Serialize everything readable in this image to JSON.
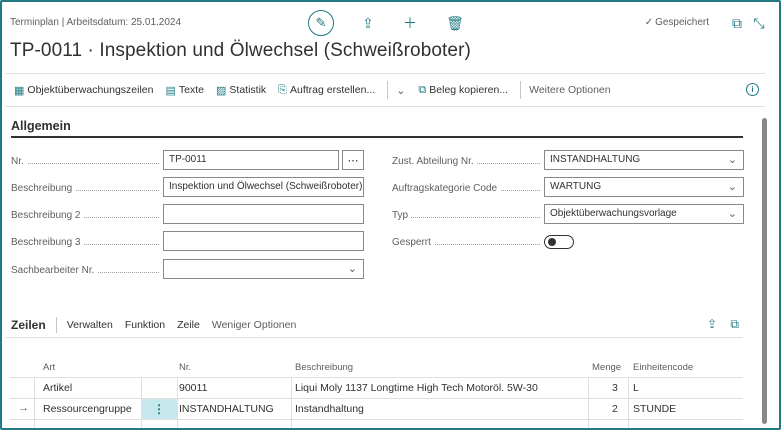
{
  "header": {
    "breadcrumb": "Terminplan | Arbeitsdatum: 25.01.2024",
    "saved_label": "Gespeichert",
    "title": "TP-0011 · Inspektion und Ölwechsel (Schweißroboter)"
  },
  "actions": {
    "items": [
      {
        "label": "Objektüberwachungszeilen",
        "icon": "grid-icon"
      },
      {
        "label": "Texte",
        "icon": "notes-icon"
      },
      {
        "label": "Statistik",
        "icon": "chart-icon"
      },
      {
        "label": "Auftrag erstellen...",
        "icon": "create-order-icon"
      },
      {
        "label": "Beleg kopieren...",
        "icon": "copy-icon"
      }
    ],
    "more_label": "Weitere Optionen"
  },
  "general": {
    "section_title": "Allgemein",
    "fields_left": [
      {
        "label": "Nr.",
        "value": "TP-0011"
      },
      {
        "label": "Beschreibung",
        "value": "Inspektion und Ölwechsel (Schweißroboter)"
      },
      {
        "label": "Beschreibung 2",
        "value": ""
      },
      {
        "label": "Beschreibung 3",
        "value": ""
      },
      {
        "label": "Sachbearbeiter Nr.",
        "value": ""
      }
    ],
    "fields_right": [
      {
        "label": "Zust. Abteilung Nr.",
        "value": "INSTANDHALTUNG"
      },
      {
        "label": "Auftragskategorie Code",
        "value": "WARTUNG"
      },
      {
        "label": "Typ",
        "value": "Objektüberwachungsvorlage"
      },
      {
        "label": "Gesperrt",
        "value": ""
      }
    ]
  },
  "lines": {
    "title": "Zeilen",
    "tabs": [
      "Verwalten",
      "Funktion",
      "Zeile",
      "Weniger Optionen"
    ],
    "columns": [
      "Art",
      "Nr.",
      "Beschreibung",
      "Menge",
      "Einheitencode"
    ],
    "rows": [
      {
        "art": "Artikel",
        "nr": "90011",
        "beschreibung": "Liqui Moly 1137 Longtime High Tech Motoröl. 5W-30",
        "menge": "3",
        "einheit": "L"
      },
      {
        "art": "Ressourcengruppe",
        "nr": "INSTANDHALTUNG",
        "beschreibung": "Instandhaltung",
        "menge": "2",
        "einheit": "STUNDE"
      }
    ]
  },
  "colors": {
    "accent": "#1f7a82",
    "row_highlight": "#c7e9ee"
  }
}
